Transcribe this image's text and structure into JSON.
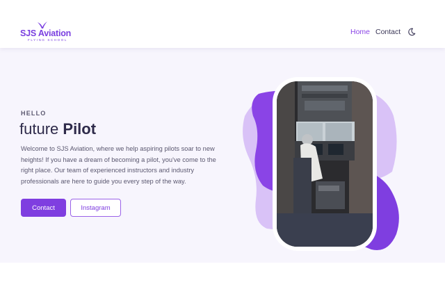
{
  "brand": {
    "name": "SJS Aviation",
    "tagline": "FLYING SCHOOL",
    "accent": "#7f3ee0",
    "logo_icon": "bird-icon"
  },
  "nav": {
    "items": [
      {
        "label": "Home",
        "active": true
      },
      {
        "label": "Contact",
        "active": false
      }
    ],
    "theme_toggle_icon": "moon-icon"
  },
  "hero": {
    "eyebrow": "HELLO",
    "headline_light": "future",
    "headline_bold": "Pilot",
    "description": "Welcome to SJS Aviation, where we help aspiring pilots soar to new heights! If you have a dream of becoming a pilot, you've come to the right place. Our team of experienced instructors and industry professionals are here to guide you every step of the way.",
    "buttons": {
      "primary": "Contact",
      "secondary": "Instagram"
    },
    "image": "cockpit-photo"
  },
  "colors": {
    "hero_bg": "#f7f5fd",
    "blob_dark": "#8a44e6",
    "blob_light": "#d6bdf6"
  }
}
